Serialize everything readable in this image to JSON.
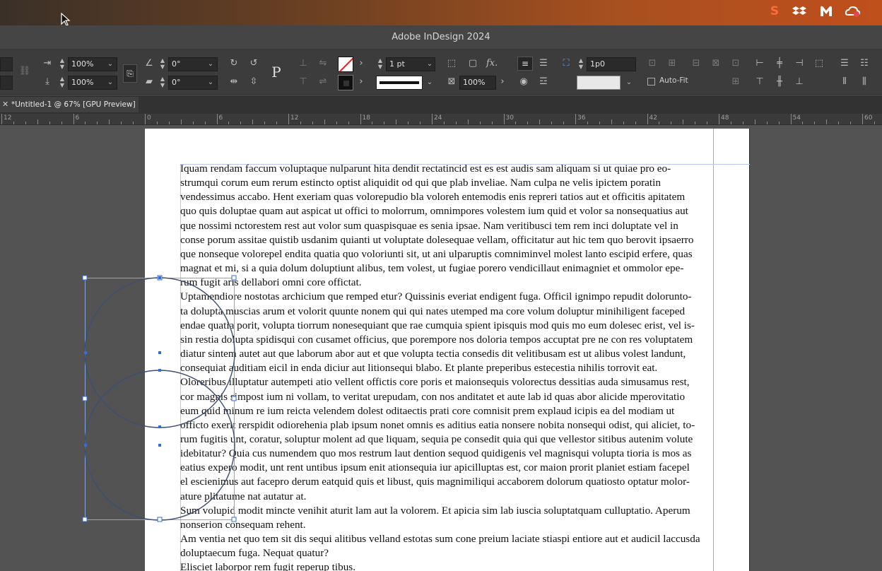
{
  "menubar": {
    "icons": [
      "s-logo-icon",
      "dropbox-icon",
      "malwarebytes-icon",
      "creative-cloud-icon"
    ]
  },
  "app": {
    "title": "Adobe InDesign 2024"
  },
  "control": {
    "scale_x": "100%",
    "scale_y": "100%",
    "rotate": "0°",
    "shear": "0°",
    "stroke_weight": "1 pt",
    "opacity": "100%",
    "gap": "1p0",
    "autofit_label": "Auto-Fit",
    "paragraph_glyph": "P",
    "fx_label": "fx."
  },
  "tab": {
    "title": "*Untitled-1 @ 67% [GPU Preview]"
  },
  "ruler": {
    "labels": [
      "12",
      "6",
      "0",
      "6",
      "12",
      "18",
      "24",
      "30",
      "36",
      "42",
      "48",
      "54",
      "60"
    ]
  },
  "document": {
    "lines": [
      "Iquam rendam faccum voluptaque nulparunt hita dendit rectatincid est es est audis sam aliquam si ut quiae pro eo-",
      "strumqui corum eum rerum estincto optist aliquidit od qui que plab inveliae. Nam culpa ne velis ipictem poratin",
      "vendessimus accabo. Hent exeriam quas volorepudio bla voloreh entemodis enis repreri tatios aut et officitis apitatem",
      "quo quis doluptae quam aut aspicat ut offici to molorrum, omnimpores volestem ium quid et volor sa nonsequatius aut",
      "que nossimi nctorestem rest aut volor sum quaspisquae es senia ipsae. Nam veritibusci tem rem inci doluptate vel in",
      "conse porum assitae quistib usdanim quianti ut voluptate dolesequae vellam, officitatur aut hic tem quo berovit ipsaerro",
      "que nonseque volorepel endita quatia quo voloriunti sit, ut ani ulparuptis comniminvel molest lanto escipid erfere, quas",
      "magnat et mi, si a quia dolum doluptiunt alibus, tem volest, ut fugiae porero vendicillaut enimagniet et ommolor epe-",
      "rum fugit aris dellabori omni core offictat.",
      "Uptamendiore nostotas archicium que remped etur? Quissinis everiat endigent fuga. Officil ignimpo repudit dolorunto-",
      "ta dolupta muscias arum et volorit quunte nonem qui qui nates utemped ma core volum doluptur minihiligent faceped",
      "endae quatia porit, volupta tiorrum nonesequiant que rae cumquia spient ipisquis mod quis mo eum dolesec erist, vel is-",
      "sin restia dolupta spidisqui con cusamet officius, que porempore nos doloria tempos accuptat pre ne con res voluptatem",
      "diatur sintem autet aut que laborum abor aut et que volupta tectia consedis dit velitibusam est ut alibus volest landunt,",
      "consequiat auditiam eicil in enda diciur aut litionsequi blabo. Et plante preperibus estecestia nihilis torrovit eat.",
      "Oloreribus illuptatur autempeti atio vellent offictis core poris et maionsequis volorectus dessitias auda simusamus rest,",
      "cor magnis simpost ium ni vollam, to veritat urepudam, con nos anditatet et aute lab id quas abor alicide mperovitatio",
      "eum quid minum re ium reicta velendem dolest oditaectis prati core comnisit prem explaud icipis ea del modiam ut",
      "officto exerit rerspidit odiorehenia plab ipsum nonet omnis es aditius eatia nonsere nobita nonsequi odist, qui aliciet, to-",
      "rum fugitis unt, coratur, soluptur molent ad que liquam, sequia pe consedit quia qui que vellestor sitibus autenim volute",
      "idebitatur? Quia cus numendem quo mos restrum laut dention sequod quidigenis vel magnisqui volupta tioria is mos as",
      "eatius expero modit, unt rent untibus ipsum enit ationsequia iur apicilluptas est, cor maion prorit planiet estiam facepel",
      "el escienimus aut facepro derum eatquid quis et libust, quis magnimiliqui accaborem dolorum quatiosto optatur molor-",
      "ature plitatume nat autatur at.",
      "Sum volupid modit mincte venihit aturit lam aut la volorem. Et apicia sim lab iuscia soluptatquam culluptatio. Aperum",
      "nonserion consequam rehent.",
      "Am ventia net quo tem sit dis sequi alitibus velland estotas sum cone preium laciate stiaspi entiore aut et audicil laccusda",
      "doluptaecum fuga. Nequat quatur?",
      "Elisciet laborpor rem fugit reperup tibus."
    ]
  },
  "colors": {
    "page": "#ffffff",
    "pasteboard": "#535353",
    "selection": "#2f6fd6",
    "ellipse_stroke": "#3d4f74"
  }
}
